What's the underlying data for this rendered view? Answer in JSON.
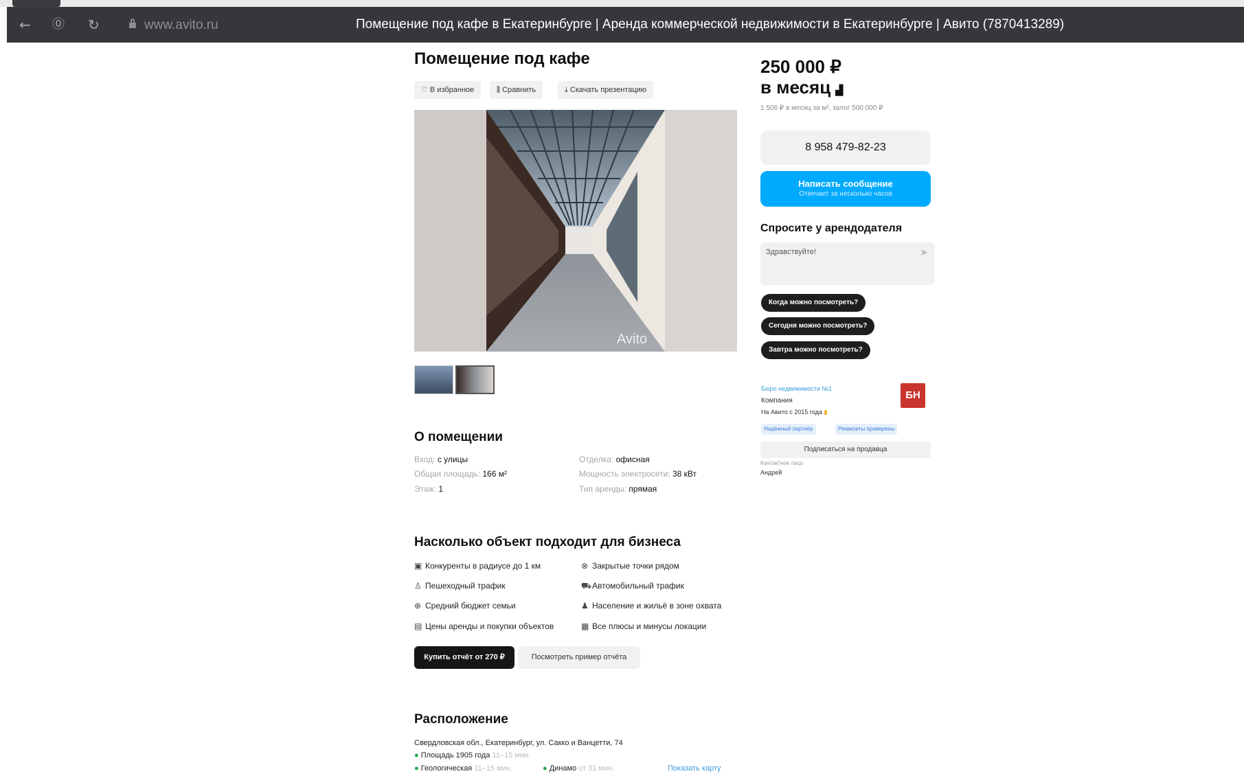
{
  "browser": {
    "url": "www.avito.ru",
    "window_title": "Помещение под кафе в Екатеринбурге | Аренда коммерческой недвижимости в Екатеринбурге | Авито (7870413289)"
  },
  "listing": {
    "title": "Помещение под кафе",
    "actions": {
      "favorite": "♡ В избранное",
      "compare": "⫼ Сравнить",
      "download": "⤓ Скачать презентацию"
    },
    "photo_watermark": "Avito"
  },
  "about": {
    "heading": "О помещении",
    "props": [
      {
        "label": "Вход: ",
        "value": "с улицы"
      },
      {
        "label": "Общая площадь: ",
        "value": "166 м²"
      },
      {
        "label": "Этаж: ",
        "value": "1"
      },
      {
        "label": "Отделка: ",
        "value": "офисная"
      },
      {
        "label": "Мощность электросети: ",
        "value": "38 кВт"
      },
      {
        "label": "Тип аренды: ",
        "value": "прямая"
      }
    ]
  },
  "business": {
    "heading": "Насколько объект подходит для бизнеса",
    "features": [
      "Конкуренты в радиусе до 1 км",
      "Закрытые точки рядом",
      "Пешеходный трафик",
      "Автомобильный трафик",
      "Средний бюджет семьи",
      "Население и жильё в зоне охвата",
      "Цены аренды и покупки объектов",
      "Все плюсы и минусы локации"
    ],
    "buy_button": "Купить отчёт от 270 ₽",
    "example_button": "Посмотреть пример отчёта"
  },
  "location": {
    "heading": "Расположение",
    "address": "Свердловская обл., Екатеринбург, ул. Сакко и Ванцетти, 74",
    "metro1": "Площадь 1905 года",
    "metro1_time": "11–15 мин.",
    "metro2": "Геологическая",
    "metro2_time": "11–15 мин.",
    "metro3": "Динамо",
    "metro3_time": "от 31 мин.",
    "show_map": "Показать карту"
  },
  "sidebar": {
    "price": "250 000 ₽",
    "period": "в месяц",
    "price_sub": "1 506 ₽ в месяц за м², залог 500 000 ₽",
    "phone": "8 958 479-82-23",
    "message_button": "Написать сообщение",
    "message_sub": "Отвечает за несколько часов",
    "ask_title": "Спросите у арендодателя",
    "ask_placeholder": "Здравствуйте!",
    "quick_questions": [
      "Когда можно посмотреть?",
      "Сегодня можно посмотреть?",
      "Завтра можно посмотреть?"
    ],
    "seller_name": "Бюро недвижимости №1",
    "seller_type": "Компания",
    "seller_since": "На Авито с 2015 года",
    "logo_text": "БН",
    "tags": [
      "Надёжный партнёр",
      "Реквизиты проверены"
    ],
    "subscribe": "Подписаться на продавца",
    "contact_label": "Контактное лицо",
    "contact_name": "Андрей"
  },
  "colors": {
    "accent_blue": "#00aaff",
    "dark_button": "#161616",
    "logo_red": "#c9342c"
  }
}
